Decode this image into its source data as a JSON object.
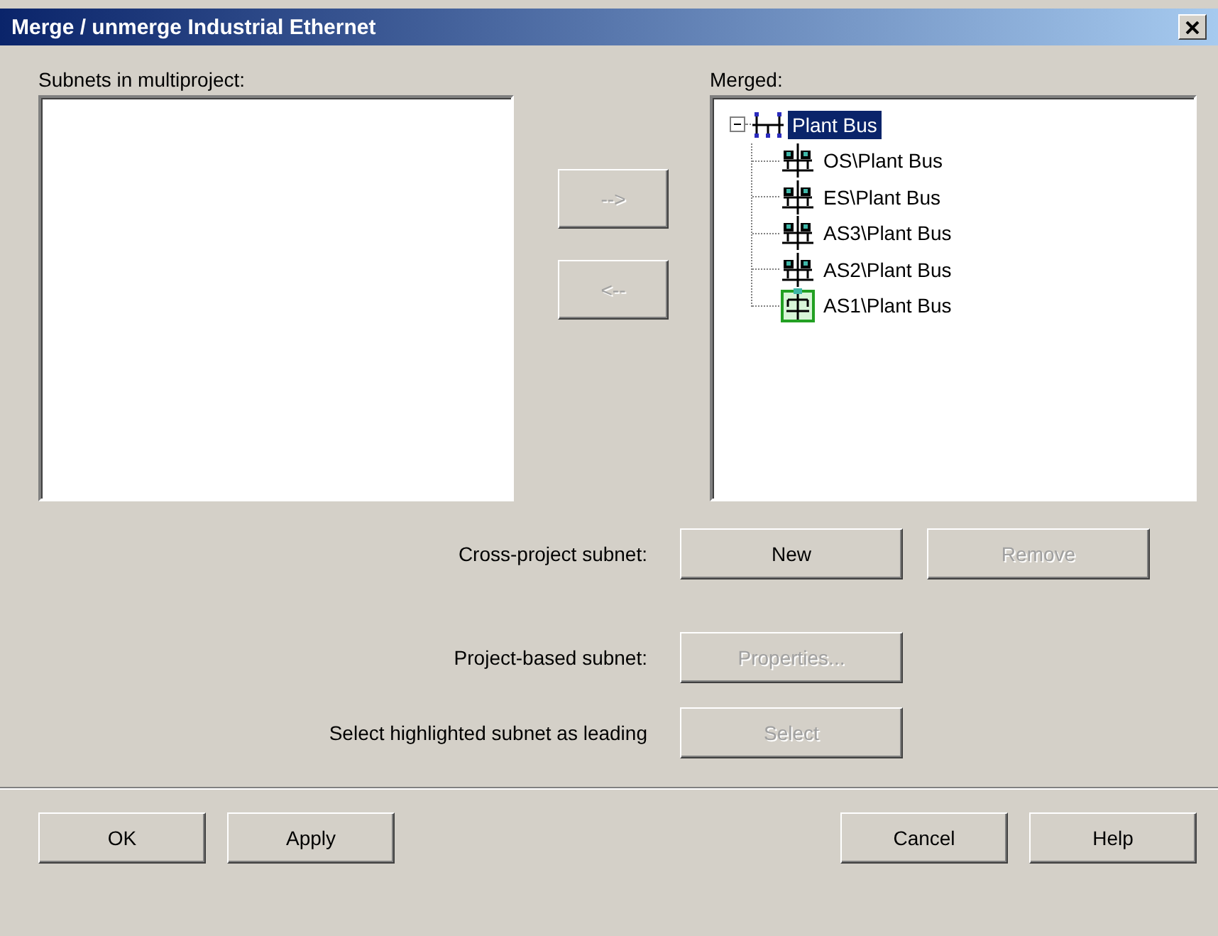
{
  "window": {
    "title": "Merge / unmerge Industrial Ethernet"
  },
  "subnets": {
    "label": "Subnets in multiproject:"
  },
  "move_buttons": [
    {
      "label": "-->",
      "disabled": true
    },
    {
      "label": "<--",
      "disabled": true
    }
  ],
  "merged": {
    "label": "Merged:",
    "tree": [
      {
        "label": "Plant Bus",
        "kind": "bus",
        "selected": true,
        "expanded": true,
        "children": [
          {
            "label": "OS\\Plant Bus",
            "kind": "station",
            "selected": false
          },
          {
            "label": "ES\\Plant Bus",
            "kind": "station",
            "selected": false
          },
          {
            "label": "AS3\\Plant Bus",
            "kind": "station",
            "selected": false
          },
          {
            "label": "AS2\\Plant Bus",
            "kind": "station",
            "selected": false
          },
          {
            "label": "AS1\\Plant Bus",
            "kind": "leading",
            "selected": false
          }
        ]
      }
    ]
  },
  "rows": [
    {
      "label": "Cross-project subnet:",
      "buttons": [
        {
          "label": "New",
          "disabled": false
        },
        {
          "label": "Remove",
          "disabled": true
        }
      ]
    },
    {
      "label": "Project-based subnet:",
      "buttons": [
        {
          "label": "Properties...",
          "disabled": true
        }
      ]
    },
    {
      "label": "Select highlighted subnet as leading",
      "buttons": [
        {
          "label": "Select",
          "disabled": true
        }
      ]
    }
  ],
  "footer_left": [
    {
      "label": "OK",
      "disabled": false
    },
    {
      "label": "Apply",
      "disabled": false
    }
  ],
  "footer_right": [
    {
      "label": "Cancel",
      "disabled": false
    },
    {
      "label": "Help",
      "disabled": false
    }
  ]
}
